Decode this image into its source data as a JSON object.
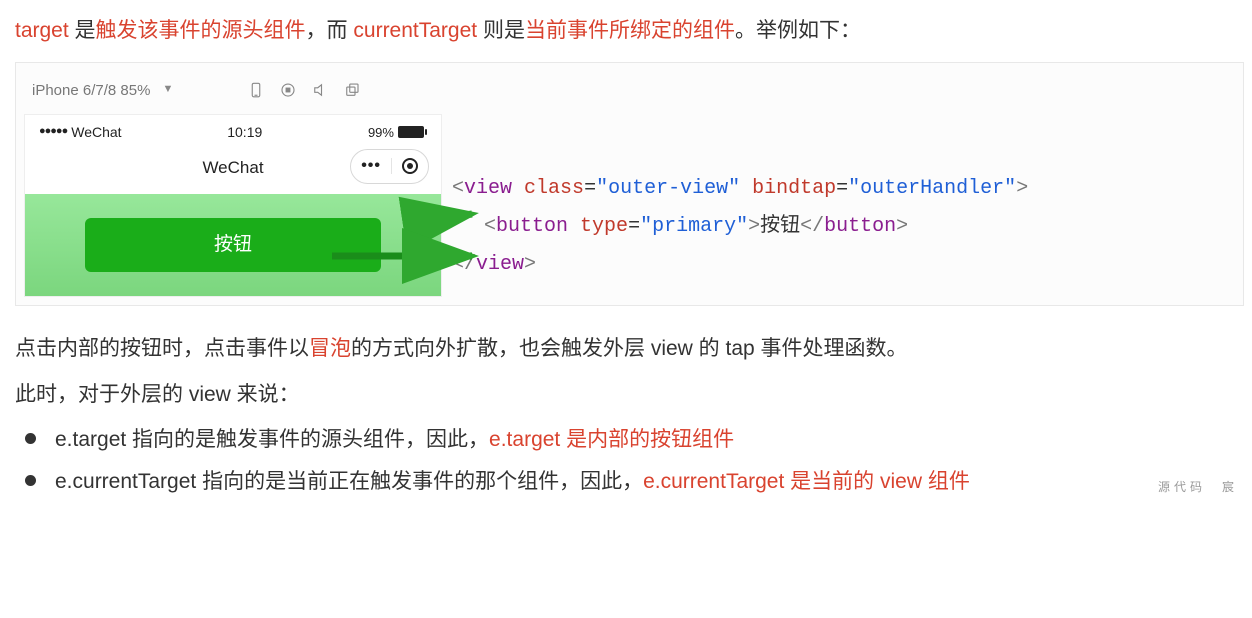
{
  "intro": {
    "t1": "target",
    "t2": " 是",
    "t3": "触发该事件的源头组件",
    "t4": "，而 ",
    "t5": "currentTarget",
    "t6": " 则是",
    "t7": "当前事件所绑定的组件",
    "t8": "。举例如下："
  },
  "toolbar": {
    "device": "iPhone 6/7/8 85%"
  },
  "status": {
    "carrier": "WeChat",
    "time": "10:19",
    "battery": "99%"
  },
  "nav": {
    "title": "WeChat",
    "more": "•••"
  },
  "button": {
    "label": "按钮"
  },
  "code": {
    "l1": {
      "open": "<",
      "tag": "view",
      "sp": " ",
      "a1n": "class",
      "eq1": "=",
      "a1v": "\"outer-view\"",
      "sp2": " ",
      "a2n": "bindtap",
      "eq2": "=",
      "a2v": "\"outerHandler\"",
      "close": ">"
    },
    "l2": {
      "open": "<",
      "tag": "button",
      "sp": " ",
      "a1n": "type",
      "eq1": "=",
      "a1v": "\"primary\"",
      "close": ">",
      "text": "按钮",
      "open2": "</",
      "tag2": "button",
      "close2": ">"
    },
    "l3": {
      "open": "</",
      "tag": "view",
      "close": ">"
    }
  },
  "para1": "点击内部的按钮时，点击事件以",
  "para1b": "冒泡",
  "para1c": "的方式向外扩散，也会触发外层 view 的 tap 事件处理函数。",
  "para2": "此时，对于外层的 view 来说：",
  "bullets": {
    "b1a": "e.target 指向的是触发事件的源头组件，因此，",
    "b1b": "e.target 是内部的按钮组件",
    "b2a": "e.currentTarget 指向的是当前正在触发事件的那个组件，因此，",
    "b2b": "e.currentTarget 是当前的 view 组件"
  },
  "watermark": "源代码　宸"
}
